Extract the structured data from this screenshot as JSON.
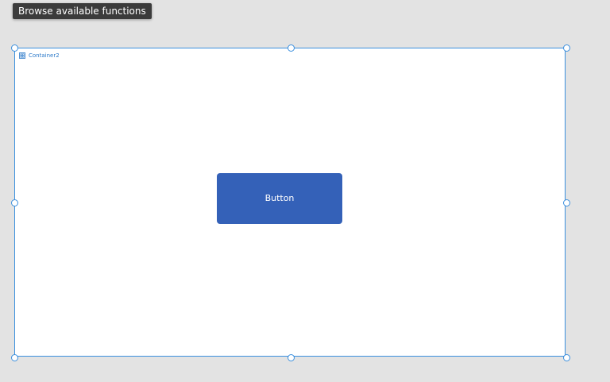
{
  "tooltip": {
    "text": "Browse available functions"
  },
  "container": {
    "name": "Container2",
    "icon": "container-icon"
  },
  "button": {
    "label": "Button"
  },
  "colors": {
    "canvas_background": "#e3e3e3",
    "selection": "#3a8fde",
    "button_fill": "#3461b8",
    "tooltip_background": "#3b3b3b"
  }
}
